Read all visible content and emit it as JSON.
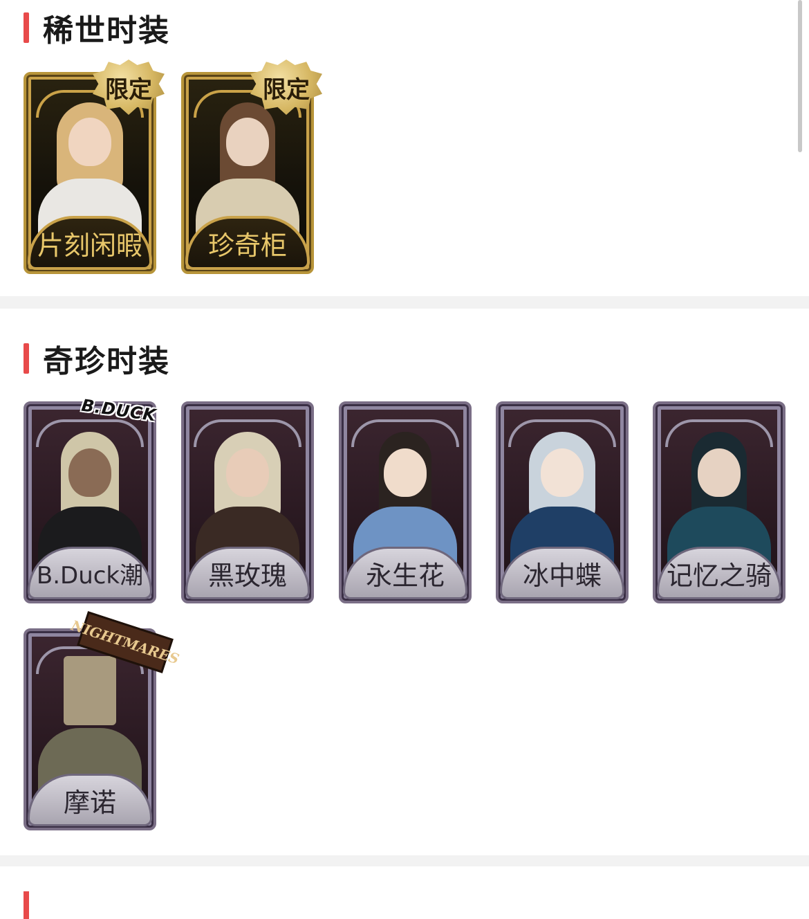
{
  "sections": {
    "rare": {
      "title": "稀世时装",
      "items": [
        {
          "name": "片刻闲暇",
          "badge": "限定",
          "frame": "gold",
          "hair": "#d9b57a",
          "skin": "#f0d5c0",
          "outfit": "#e9e7e3"
        },
        {
          "name": "珍奇柜",
          "badge": "限定",
          "frame": "gold",
          "hair": "#6b4a33",
          "skin": "#e9d2bf",
          "outfit": "#d8ccb0"
        }
      ]
    },
    "premium": {
      "title": "奇珍时装",
      "items": [
        {
          "name": "B.Duck潮",
          "tag": "B.DUCK",
          "frame": "purple",
          "hair": "#cfc6a8",
          "skin": "#8a6b55",
          "outfit": "#1b1b1d"
        },
        {
          "name": "黑玫瑰",
          "frame": "purple",
          "hair": "#d8cfb6",
          "skin": "#e8ccb8",
          "outfit": "#3a2a24"
        },
        {
          "name": "永生花",
          "frame": "purple",
          "hair": "#2b2320",
          "skin": "#f0dccb",
          "outfit": "#6e93c4"
        },
        {
          "name": "冰中蝶",
          "frame": "purple",
          "hair": "#c9d3dc",
          "skin": "#f2e2d6",
          "outfit": "#1f3f66"
        },
        {
          "name": "记忆之骑",
          "frame": "purple",
          "hair": "#1a2a32",
          "skin": "#e6d2c2",
          "outfit": "#1e4a5c"
        },
        {
          "name": "摩诺",
          "tag": "NIGHTMARES",
          "frame": "purple",
          "hair": "#b7a98a",
          "skin": "#a89a7e",
          "outfit": "#6d6a55"
        }
      ]
    }
  },
  "colors": {
    "accent_bar": "#e84a4a",
    "divider": "#f2f2f2"
  }
}
